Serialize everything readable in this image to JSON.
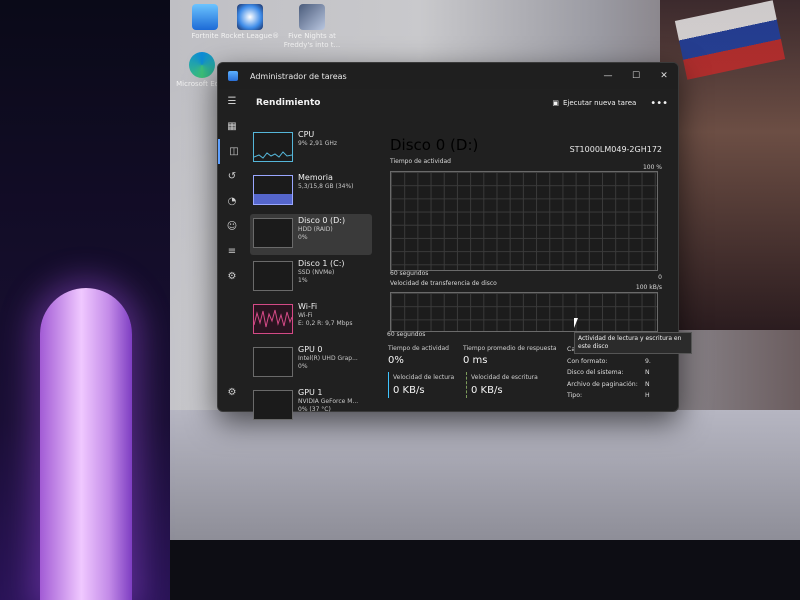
{
  "desktop": {
    "icons": [
      {
        "label": "Fortnite"
      },
      {
        "label": "Rocket League®"
      },
      {
        "label": "Five Nights at Freddy's into t..."
      },
      {
        "label": "Microsoft Edge"
      }
    ]
  },
  "window": {
    "title": "Administrador de tareas",
    "controls": {
      "minimize": "—",
      "maximize": "☐",
      "close": "✕"
    }
  },
  "header": {
    "title": "Rendimiento",
    "run_task_label": "Ejecutar nueva tarea",
    "more": "•••"
  },
  "nav": {
    "icons": [
      "hamburger-icon",
      "processes-icon",
      "performance-icon",
      "history-icon",
      "startup-icon",
      "users-icon",
      "details-icon",
      "services-icon"
    ],
    "settings_icon": "settings-icon"
  },
  "perf_list": [
    {
      "name": "CPU",
      "sub1": "9% 2,91 GHz",
      "sub2": "",
      "sub3": ""
    },
    {
      "name": "Memoria",
      "sub1": "5,3/15,8 GB (34%)",
      "sub2": "",
      "sub3": ""
    },
    {
      "name": "Disco 0 (D:)",
      "sub1": "HDD (RAID)",
      "sub2": "0%",
      "sub3": ""
    },
    {
      "name": "Disco 1 (C:)",
      "sub1": "SSD (NVMe)",
      "sub2": "1%",
      "sub3": ""
    },
    {
      "name": "Wi-Fi",
      "sub1": "Wi-Fi",
      "sub2": "E: 0,2 R: 9,7 Mbps",
      "sub3": ""
    },
    {
      "name": "GPU 0",
      "sub1": "Intel(R) UHD Grap...",
      "sub2": "0%",
      "sub3": ""
    },
    {
      "name": "GPU 1",
      "sub1": "NVIDIA GeForce M...",
      "sub2": "0% (37 °C)",
      "sub3": ""
    }
  ],
  "detail": {
    "title": "Disco 0 (D:)",
    "model": "ST1000LM049-2GH172",
    "active_time_label": "Tiempo de actividad",
    "active_time_max": "100 %",
    "x_label": "60 segundos",
    "x_min": "0",
    "transfer_label": "Velocidad de transferencia de disco",
    "transfer_max": "100 kB/s",
    "x_label2": "60 segundos",
    "stats": {
      "active_time_label": "Tiempo de actividad",
      "active_time_value": "0%",
      "avg_response_label": "Tiempo promedio de respuesta",
      "avg_response_value": "0 ms",
      "read_label": "Velocidad de lectura",
      "read_value": "0 KB/s",
      "write_label": "Velocidad de escritura",
      "write_value": "0 KB/s"
    },
    "props": [
      {
        "label": "Capacidad:",
        "value": "9."
      },
      {
        "label": "Con formato:",
        "value": "9."
      },
      {
        "label": "Disco del sistema:",
        "value": "N"
      },
      {
        "label": "Archivo de paginación:",
        "value": "N"
      },
      {
        "label": "Tipo:",
        "value": "H"
      }
    ],
    "tooltip": "Actividad de lectura y escritura en este disco"
  },
  "colors": {
    "accent": "#5ea0ff",
    "read_bar": "#3fc4ff",
    "write_bar": "#7c9c5b"
  }
}
